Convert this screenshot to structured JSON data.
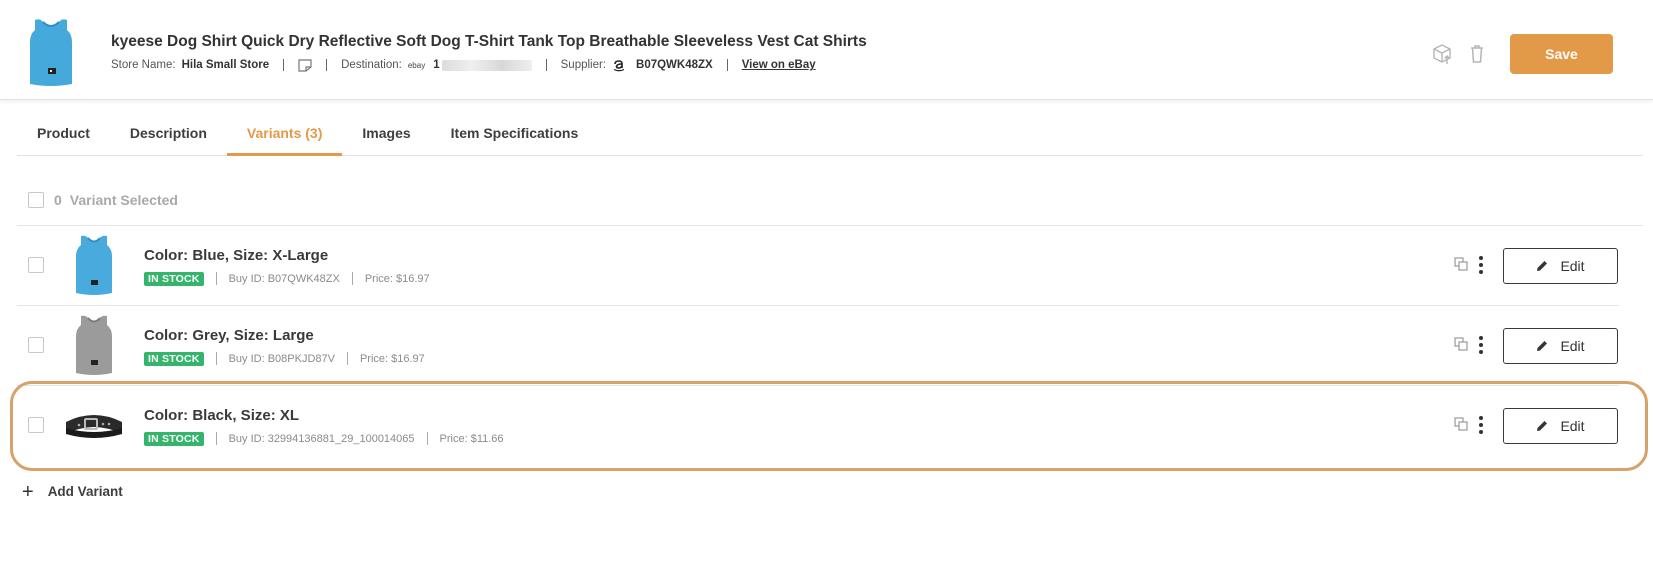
{
  "header": {
    "title": "kyeese Dog Shirt Quick Dry Reflective Soft Dog T-Shirt Tank Top Breathable Sleeveless Vest Cat Shirts",
    "store_label": "Store Name:",
    "store_name": "Hila Small Store",
    "destination_label": "Destination:",
    "destination_logo": "ebay",
    "destination_value": "1",
    "supplier_label": "Supplier:",
    "supplier_id": "B07QWK48ZX",
    "view_link": "View on eBay",
    "save_label": "Save"
  },
  "tabs": [
    {
      "label": "Product",
      "active": false
    },
    {
      "label": "Description",
      "active": false
    },
    {
      "label": "Variants (3)",
      "active": true
    },
    {
      "label": "Images",
      "active": false
    },
    {
      "label": "Item Specifications",
      "active": false
    }
  ],
  "selection": {
    "count": "0",
    "label": "Variant Selected"
  },
  "variants": [
    {
      "title": "Color: Blue, Size: X-Large",
      "stock": "IN STOCK",
      "buy_id": "Buy ID: B07QWK48ZX",
      "price": "Price: $16.97",
      "image": "blue-shirt"
    },
    {
      "title": "Color: Grey, Size: Large",
      "stock": "IN STOCK",
      "buy_id": "Buy ID: B08PKJD87V",
      "price": "Price: $16.97",
      "image": "grey-shirt"
    },
    {
      "title": "Color: Black, Size: XL",
      "stock": "IN STOCK",
      "buy_id": "Buy ID: 32994136881_29_100014065",
      "price": "Price: $11.66",
      "image": "black-collar"
    }
  ],
  "edit_label": "Edit",
  "add_variant_label": "Add Variant",
  "colors": {
    "accent": "#e39a48",
    "in_stock": "#35b46b",
    "highlight": "#d8a06a"
  }
}
